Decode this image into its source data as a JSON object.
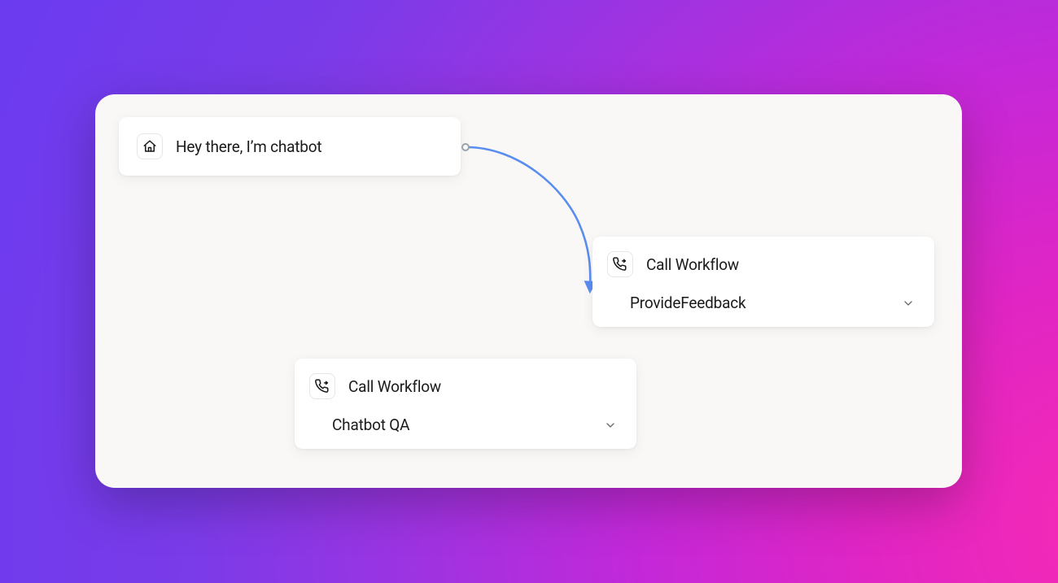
{
  "colors": {
    "connector": "#5a8df0",
    "canvas_bg": "#faf8f6",
    "card_bg": "#ffffff"
  },
  "nodes": {
    "start": {
      "icon": "home-icon",
      "title": "Hey there, I’m chatbot"
    },
    "feedback": {
      "icon": "phone-forward-icon",
      "title": "Call Workflow",
      "selected": "ProvideFeedback"
    },
    "qa": {
      "icon": "phone-forward-icon",
      "title": "Call Workflow",
      "selected": "Chatbot QA"
    }
  }
}
